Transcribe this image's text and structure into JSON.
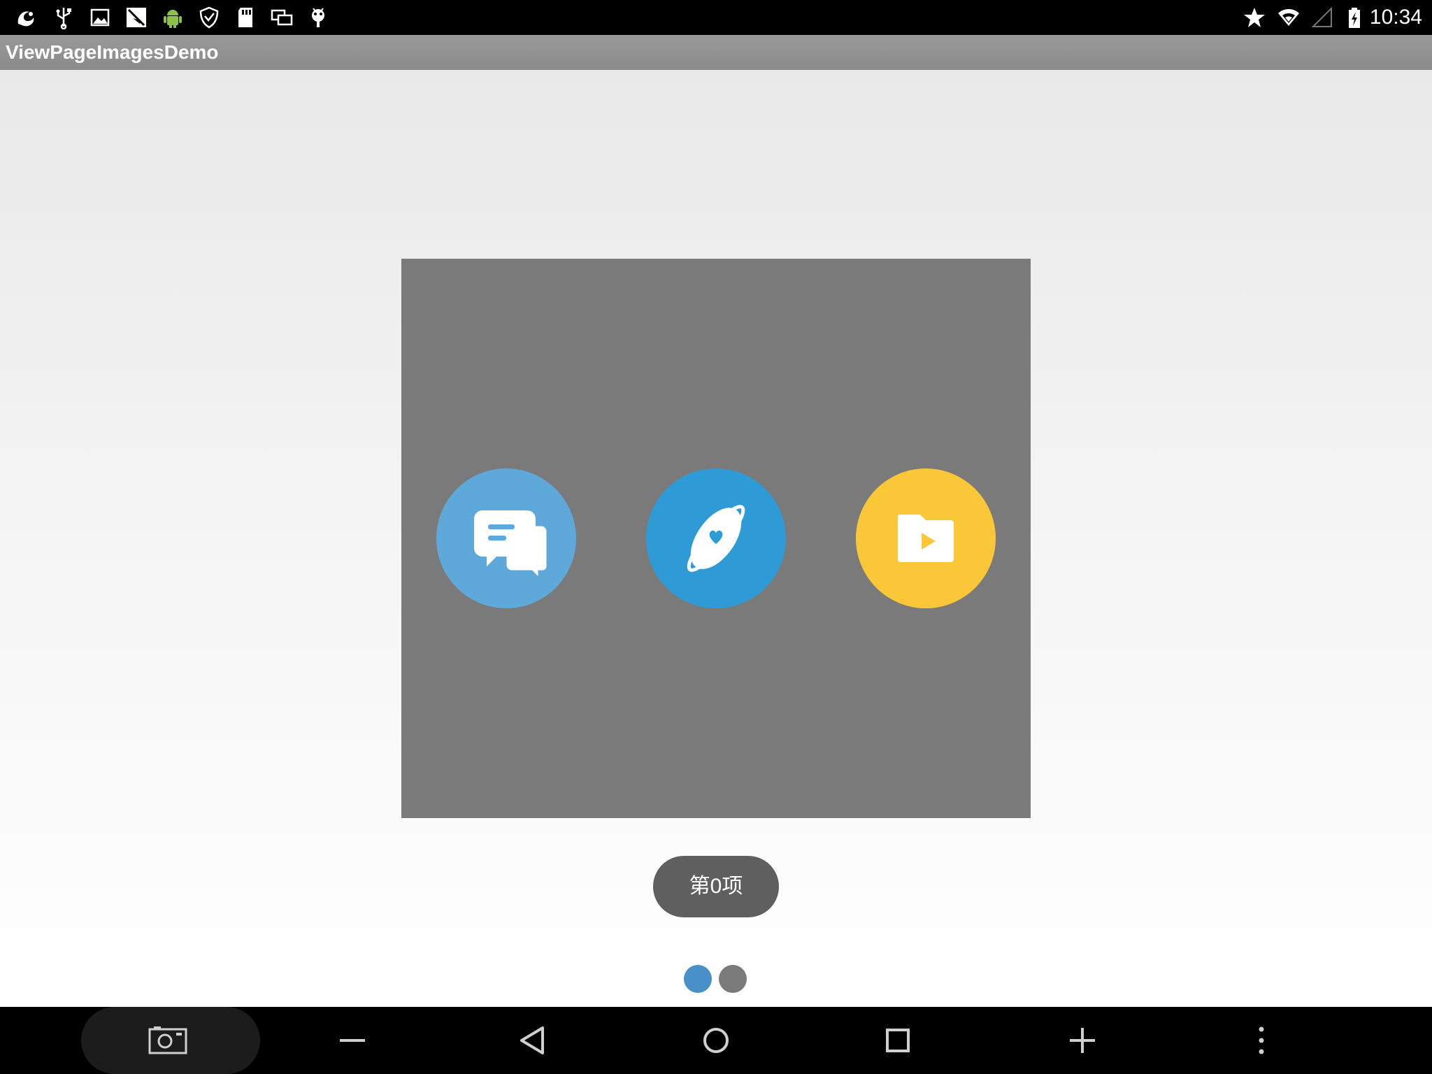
{
  "status_bar": {
    "time": "10:34",
    "left_icons": [
      "uc-browser-icon",
      "usb-icon",
      "image-icon",
      "no-sim-icon",
      "android-icon",
      "shield-icon",
      "sd-card-icon",
      "windows-icon",
      "debug-icon"
    ],
    "right_icons": [
      "star-icon",
      "wifi-icon",
      "signal-icon",
      "battery-charging-icon"
    ]
  },
  "action_bar": {
    "title": "ViewPageImagesDemo"
  },
  "pager": {
    "apps": [
      {
        "icon": "chat-bubbles-icon",
        "color": "#5fa8da"
      },
      {
        "icon": "orbit-heart-icon",
        "color": "#2f9bd6"
      },
      {
        "icon": "video-folder-icon",
        "color": "#f9c737"
      }
    ],
    "background": "#7a7a7a"
  },
  "toast": {
    "text": "第0项"
  },
  "page_indicator": {
    "count": 2,
    "active_index": 0,
    "active_color": "#4a90c8",
    "inactive_color": "#7a7a7a"
  },
  "nav_bar": {
    "buttons": [
      "screenshot-icon",
      "volume-down-icon",
      "back-icon",
      "home-icon",
      "recents-icon",
      "volume-up-icon",
      "menu-icon"
    ]
  }
}
